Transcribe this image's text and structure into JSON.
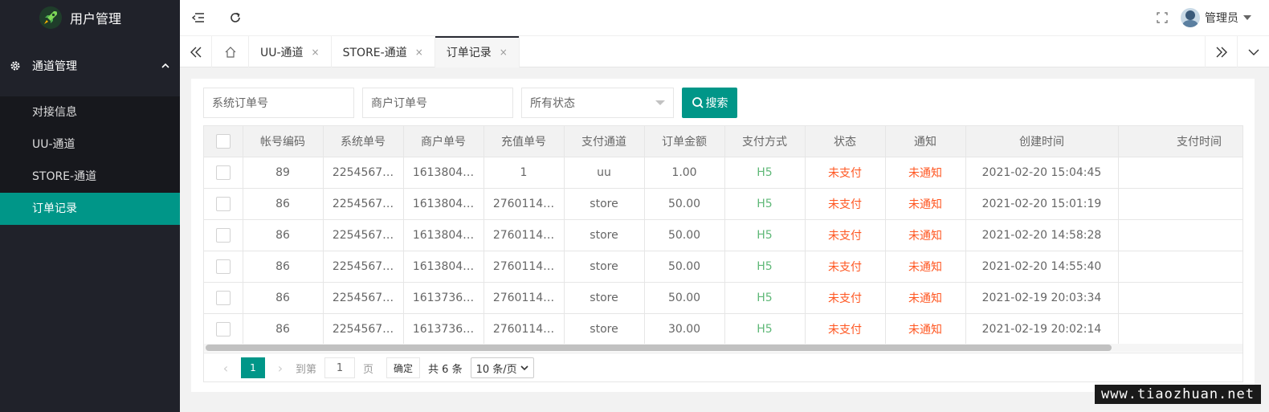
{
  "app": {
    "title": "用户管理"
  },
  "sidebar": {
    "group_label": "通道管理",
    "items": [
      {
        "label": "对接信息",
        "active": false
      },
      {
        "label": "UU-通道",
        "active": false
      },
      {
        "label": "STORE-通道",
        "active": false
      },
      {
        "label": "订单记录",
        "active": true
      }
    ]
  },
  "header": {
    "user_name": "管理员"
  },
  "tabs": [
    {
      "label": "UU-通道",
      "close": "×"
    },
    {
      "label": "STORE-通道",
      "close": "×"
    },
    {
      "label": "订单记录",
      "close": "×"
    }
  ],
  "filters": {
    "system_order_placeholder": "系统订单号",
    "merchant_order_placeholder": "商户订单号",
    "status_select": "所有状态",
    "search_label": "搜索"
  },
  "table": {
    "columns": [
      "帐号编码",
      "系统单号",
      "商户单号",
      "充值单号",
      "支付通道",
      "订单金额",
      "支付方式",
      "状态",
      "通知",
      "创建时间",
      "支付时间"
    ],
    "rows": [
      [
        "89",
        "2254567…",
        "1613804…",
        "1",
        "uu",
        "1.00",
        "H5",
        "未支付",
        "未通知",
        "2021-02-20 15:04:45",
        ""
      ],
      [
        "86",
        "2254567…",
        "1613804…",
        "2760114…",
        "store",
        "50.00",
        "H5",
        "未支付",
        "未通知",
        "2021-02-20 15:01:19",
        ""
      ],
      [
        "86",
        "2254567…",
        "1613804…",
        "2760114…",
        "store",
        "50.00",
        "H5",
        "未支付",
        "未通知",
        "2021-02-20 14:58:28",
        ""
      ],
      [
        "86",
        "2254567…",
        "1613804…",
        "2760114…",
        "store",
        "50.00",
        "H5",
        "未支付",
        "未通知",
        "2021-02-20 14:55:40",
        ""
      ],
      [
        "86",
        "2254567…",
        "1613736…",
        "2760114…",
        "store",
        "50.00",
        "H5",
        "未支付",
        "未通知",
        "2021-02-19 20:03:34",
        ""
      ],
      [
        "86",
        "2254567…",
        "1613736…",
        "2760114…",
        "store",
        "30.00",
        "H5",
        "未支付",
        "未通知",
        "2021-02-19 20:02:14",
        ""
      ]
    ]
  },
  "pager": {
    "current_page": "1",
    "goto_label": "到第",
    "goto_value": "1",
    "page_unit": "页",
    "confirm_label": "确定",
    "total_label": "共 6 条",
    "page_size": "10 条/页"
  },
  "watermark": "www.tiaozhuan.net",
  "colors": {
    "accent": "#009688",
    "sidebar_bg": "#20222a",
    "paid_method": "#5fb878",
    "warning": "#ff5722"
  }
}
